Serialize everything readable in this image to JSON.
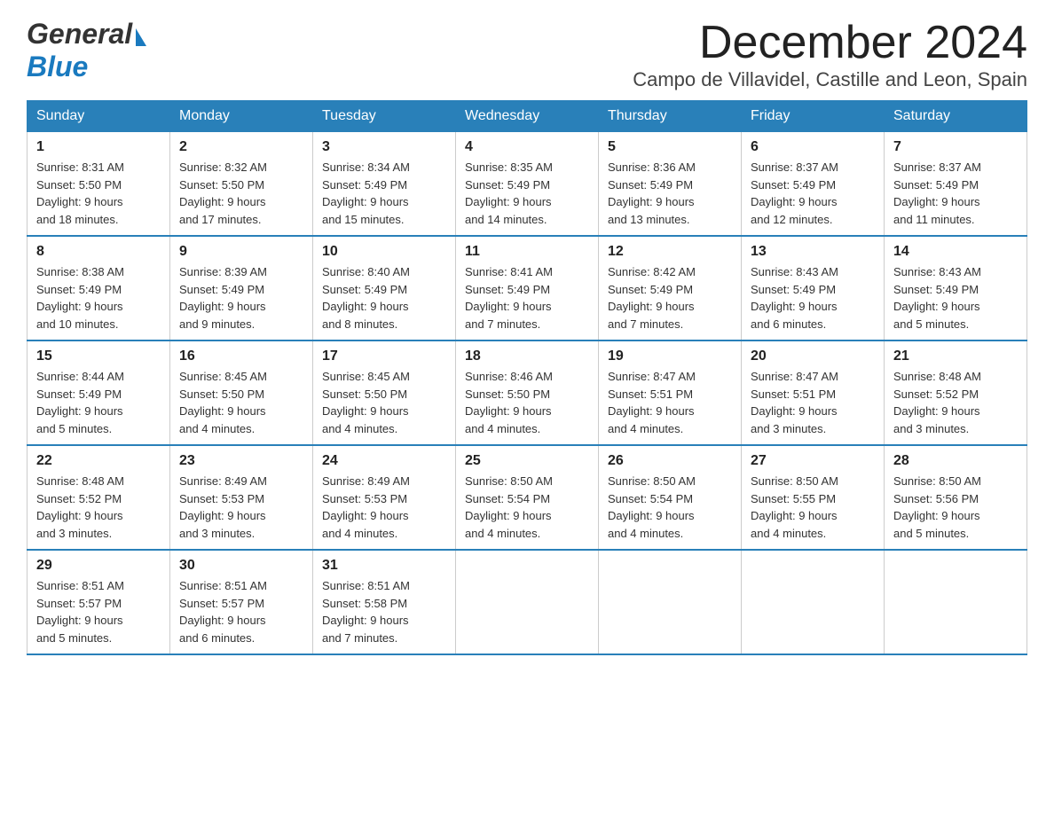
{
  "header": {
    "logo": {
      "general": "General",
      "blue": "Blue",
      "arrow": "▶"
    },
    "title": "December 2024",
    "location": "Campo de Villavidel, Castille and Leon, Spain"
  },
  "days_of_week": [
    "Sunday",
    "Monday",
    "Tuesday",
    "Wednesday",
    "Thursday",
    "Friday",
    "Saturday"
  ],
  "weeks": [
    [
      {
        "day": "1",
        "sunrise": "8:31 AM",
        "sunset": "5:50 PM",
        "daylight": "9 hours and 18 minutes."
      },
      {
        "day": "2",
        "sunrise": "8:32 AM",
        "sunset": "5:50 PM",
        "daylight": "9 hours and 17 minutes."
      },
      {
        "day": "3",
        "sunrise": "8:34 AM",
        "sunset": "5:49 PM",
        "daylight": "9 hours and 15 minutes."
      },
      {
        "day": "4",
        "sunrise": "8:35 AM",
        "sunset": "5:49 PM",
        "daylight": "9 hours and 14 minutes."
      },
      {
        "day": "5",
        "sunrise": "8:36 AM",
        "sunset": "5:49 PM",
        "daylight": "9 hours and 13 minutes."
      },
      {
        "day": "6",
        "sunrise": "8:37 AM",
        "sunset": "5:49 PM",
        "daylight": "9 hours and 12 minutes."
      },
      {
        "day": "7",
        "sunrise": "8:37 AM",
        "sunset": "5:49 PM",
        "daylight": "9 hours and 11 minutes."
      }
    ],
    [
      {
        "day": "8",
        "sunrise": "8:38 AM",
        "sunset": "5:49 PM",
        "daylight": "9 hours and 10 minutes."
      },
      {
        "day": "9",
        "sunrise": "8:39 AM",
        "sunset": "5:49 PM",
        "daylight": "9 hours and 9 minutes."
      },
      {
        "day": "10",
        "sunrise": "8:40 AM",
        "sunset": "5:49 PM",
        "daylight": "9 hours and 8 minutes."
      },
      {
        "day": "11",
        "sunrise": "8:41 AM",
        "sunset": "5:49 PM",
        "daylight": "9 hours and 7 minutes."
      },
      {
        "day": "12",
        "sunrise": "8:42 AM",
        "sunset": "5:49 PM",
        "daylight": "9 hours and 7 minutes."
      },
      {
        "day": "13",
        "sunrise": "8:43 AM",
        "sunset": "5:49 PM",
        "daylight": "9 hours and 6 minutes."
      },
      {
        "day": "14",
        "sunrise": "8:43 AM",
        "sunset": "5:49 PM",
        "daylight": "9 hours and 5 minutes."
      }
    ],
    [
      {
        "day": "15",
        "sunrise": "8:44 AM",
        "sunset": "5:49 PM",
        "daylight": "9 hours and 5 minutes."
      },
      {
        "day": "16",
        "sunrise": "8:45 AM",
        "sunset": "5:50 PM",
        "daylight": "9 hours and 4 minutes."
      },
      {
        "day": "17",
        "sunrise": "8:45 AM",
        "sunset": "5:50 PM",
        "daylight": "9 hours and 4 minutes."
      },
      {
        "day": "18",
        "sunrise": "8:46 AM",
        "sunset": "5:50 PM",
        "daylight": "9 hours and 4 minutes."
      },
      {
        "day": "19",
        "sunrise": "8:47 AM",
        "sunset": "5:51 PM",
        "daylight": "9 hours and 4 minutes."
      },
      {
        "day": "20",
        "sunrise": "8:47 AM",
        "sunset": "5:51 PM",
        "daylight": "9 hours and 3 minutes."
      },
      {
        "day": "21",
        "sunrise": "8:48 AM",
        "sunset": "5:52 PM",
        "daylight": "9 hours and 3 minutes."
      }
    ],
    [
      {
        "day": "22",
        "sunrise": "8:48 AM",
        "sunset": "5:52 PM",
        "daylight": "9 hours and 3 minutes."
      },
      {
        "day": "23",
        "sunrise": "8:49 AM",
        "sunset": "5:53 PM",
        "daylight": "9 hours and 3 minutes."
      },
      {
        "day": "24",
        "sunrise": "8:49 AM",
        "sunset": "5:53 PM",
        "daylight": "9 hours and 4 minutes."
      },
      {
        "day": "25",
        "sunrise": "8:50 AM",
        "sunset": "5:54 PM",
        "daylight": "9 hours and 4 minutes."
      },
      {
        "day": "26",
        "sunrise": "8:50 AM",
        "sunset": "5:54 PM",
        "daylight": "9 hours and 4 minutes."
      },
      {
        "day": "27",
        "sunrise": "8:50 AM",
        "sunset": "5:55 PM",
        "daylight": "9 hours and 4 minutes."
      },
      {
        "day": "28",
        "sunrise": "8:50 AM",
        "sunset": "5:56 PM",
        "daylight": "9 hours and 5 minutes."
      }
    ],
    [
      {
        "day": "29",
        "sunrise": "8:51 AM",
        "sunset": "5:57 PM",
        "daylight": "9 hours and 5 minutes."
      },
      {
        "day": "30",
        "sunrise": "8:51 AM",
        "sunset": "5:57 PM",
        "daylight": "9 hours and 6 minutes."
      },
      {
        "day": "31",
        "sunrise": "8:51 AM",
        "sunset": "5:58 PM",
        "daylight": "9 hours and 7 minutes."
      },
      null,
      null,
      null,
      null
    ]
  ],
  "labels": {
    "sunrise_prefix": "Sunrise: ",
    "sunset_prefix": "Sunset: ",
    "daylight_prefix": "Daylight: "
  }
}
